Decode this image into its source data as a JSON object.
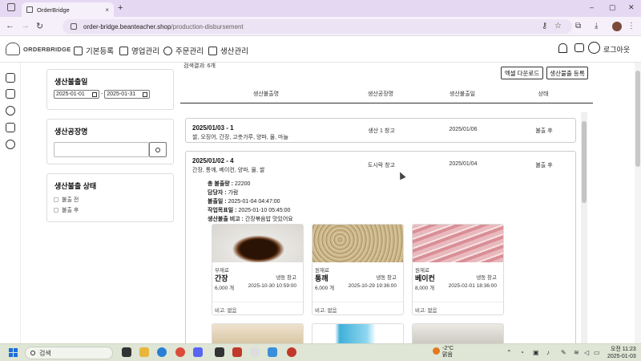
{
  "browser": {
    "tab_title": "OrderBridge",
    "tab_close": "×",
    "new_tab": "+",
    "url_host": "order-bridge.beanteacher.shop",
    "url_path": "/production-disbursement",
    "window_controls": [
      "–",
      "▢",
      "✕"
    ],
    "nav": {
      "back": "←",
      "forward": "→",
      "reload": "↻"
    }
  },
  "header": {
    "logo_text": "ORDERBRIDGE",
    "menu": [
      "기본등록",
      "영업관리",
      "주문관리",
      "생산관리"
    ],
    "logout": "로그아웃"
  },
  "filters": {
    "date": {
      "title": "생산불출일",
      "start": "2025-01-01",
      "separator": "-",
      "end": "2025-01-31"
    },
    "factory": {
      "title": "생산공장명",
      "placeholder": ""
    },
    "status": {
      "title": "생산불출 상태",
      "options": [
        "불출 전",
        "불출 후"
      ]
    }
  },
  "main": {
    "result_count": "검색결과: 6개",
    "buttons": {
      "excel": "엑셀 다운로드",
      "register": "생산불출 등록"
    },
    "columns": [
      "생산불출명",
      "생산공장명",
      "생산불출일",
      "상태"
    ],
    "rows": [
      {
        "name": "2025/01/03 - 1",
        "items": "쌀, 오징어, 간장, 고춧가루, 양파, 물, 마늘",
        "factory": "생산 1 창고",
        "date": "2025/01/06",
        "status": "불출 후"
      },
      {
        "name": "2025/01/02 - 4",
        "items": "간장, 통깨, 베이컨, 양파, 물, 쌀",
        "factory": "도시락 창고",
        "date": "2025/01/04",
        "status": "불출 후",
        "details": {
          "total_label": "총 불출량 :",
          "total": "22200",
          "manager_label": "담당자 :",
          "manager": "가람",
          "release_label": "불출일 :",
          "release": "2025-01-04 04:47:00",
          "work_label": "작업목표일 :",
          "work": "2025-01-10 05:45:00",
          "note_label": "생산불출 비고 :",
          "note": "간장볶음밥 맛있어요"
        },
        "products": [
          {
            "type": "부재료",
            "name": "간장",
            "warehouse": "냉동 창고",
            "qty": "6,000 개",
            "date": "2025-10-30 10:59:00",
            "note": "비고: 없음"
          },
          {
            "type": "원재료",
            "name": "통깨",
            "warehouse": "냉동 창고",
            "qty": "6,000 개",
            "date": "2025-10-29 19:36:00",
            "note": "비고: 없음"
          },
          {
            "type": "원재료",
            "name": "베이컨",
            "warehouse": "냉동 창고",
            "qty": "8,000 개",
            "date": "2025-02-01 18:36:00",
            "note": "비고: 없음"
          }
        ]
      }
    ]
  },
  "taskbar": {
    "search": "검색",
    "weather_temp": "-2°C",
    "weather_desc": "맑음",
    "time": "오전 11:23",
    "date": "2025-01-03"
  }
}
